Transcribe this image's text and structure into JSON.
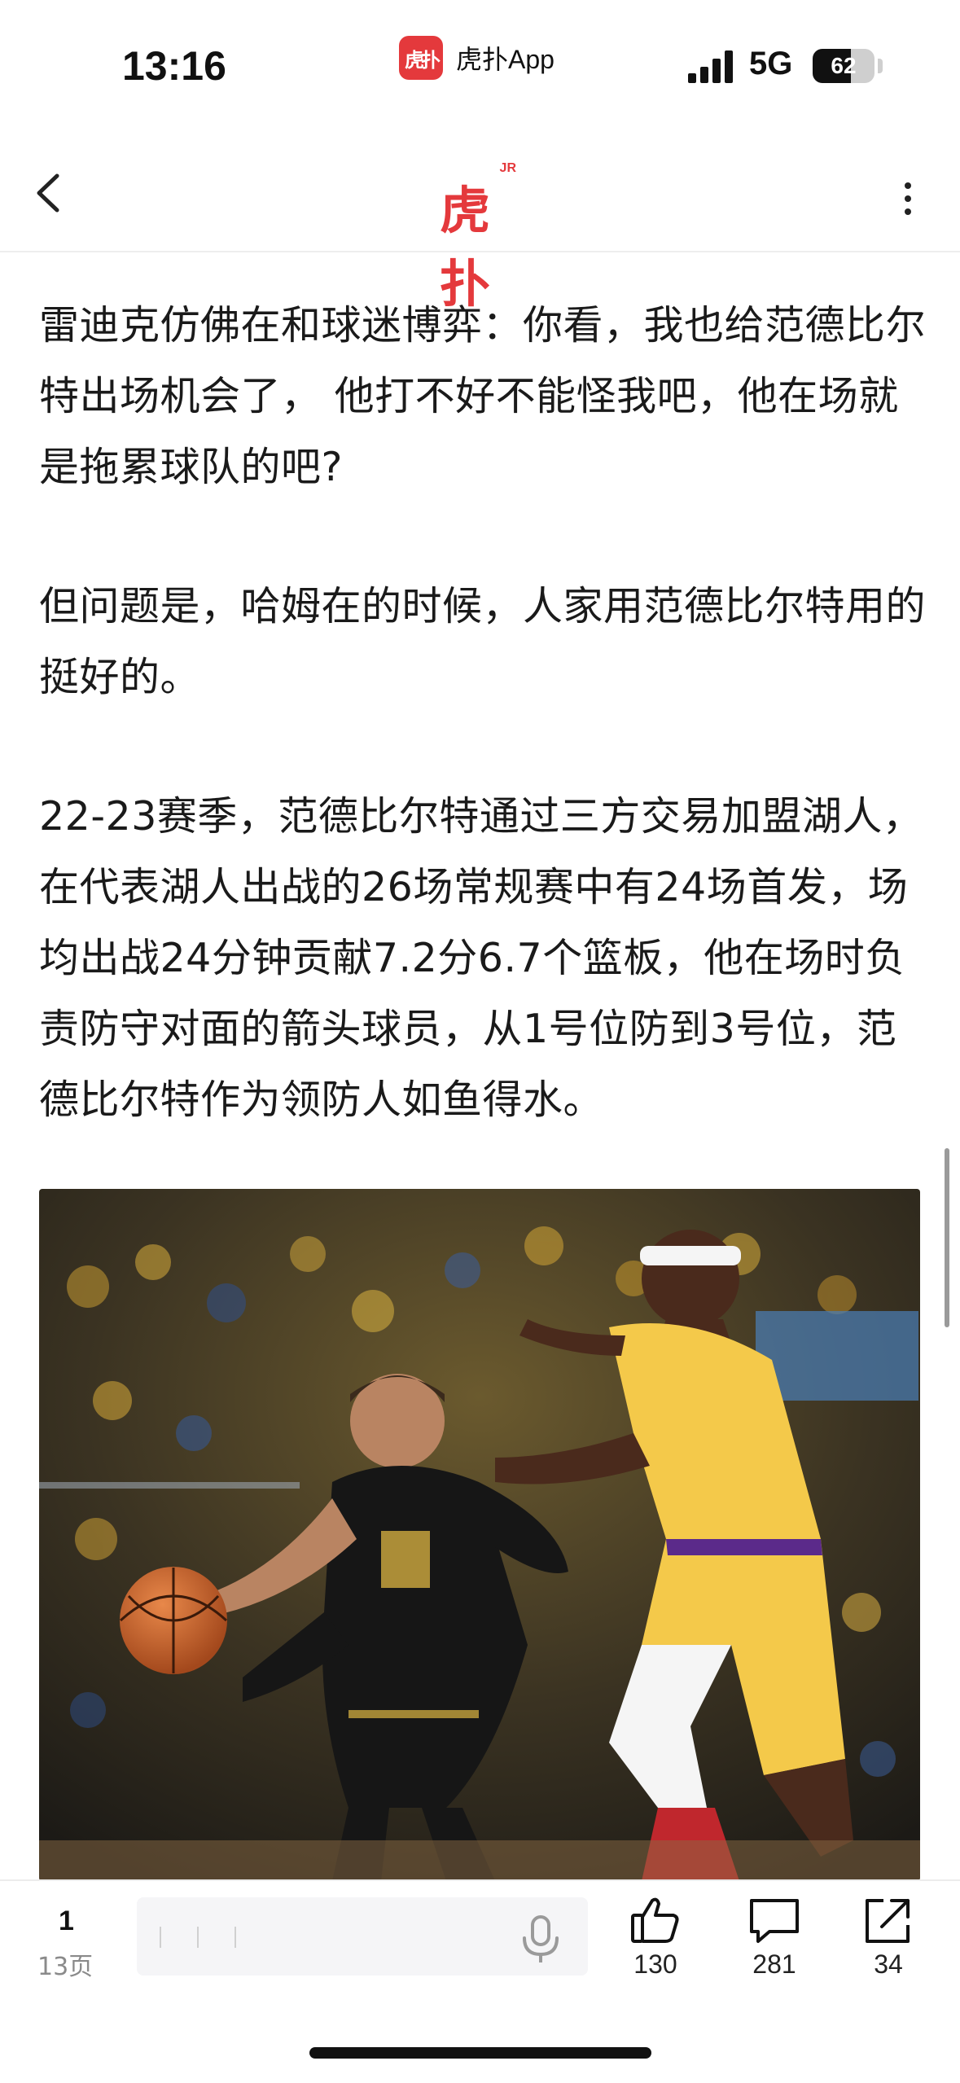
{
  "status_bar": {
    "time": "13:16",
    "app_logo_glyph": "虎扑",
    "app_name": "虎扑App",
    "network": "5G",
    "battery": "62",
    "battery_level": 0.62
  },
  "nav": {
    "brand_text": "虎扑",
    "brand_superscript": "JR",
    "back_icon": "chevron-left-icon",
    "more_icon": "vertical-ellipsis-icon"
  },
  "article": {
    "paragraphs": [
      "雷迪克仿佛在和球迷博弈：你看，我也给范德比尔特出场机会了， 他打不好不能怪我吧，他在场就是拖累球队的吧?",
      "但问题是，哈姆在的时候，人家用范德比尔特用的挺好的。",
      "22-23赛季，范德比尔特通过三方交易加盟湖人，在代表湖人出战的26场常规赛中有24场首发，场均出战24分钟贡献7.2分6.7个篮板，他在场时负责防守对面的箭头球员，从1号位防到3号位，范德比尔特作为领防人如鱼得水。"
    ],
    "image_icon": "basketball-photo"
  },
  "bottom_bar": {
    "page_current": "1",
    "page_total": "13页",
    "comment_placeholder": "",
    "mic_icon": "microphone-icon",
    "like_count": "130",
    "comment_count": "281",
    "share_count": "34"
  },
  "colors": {
    "brand_red": "#e4393c",
    "text": "#1a1a1a",
    "muted": "#8a8a8a"
  }
}
